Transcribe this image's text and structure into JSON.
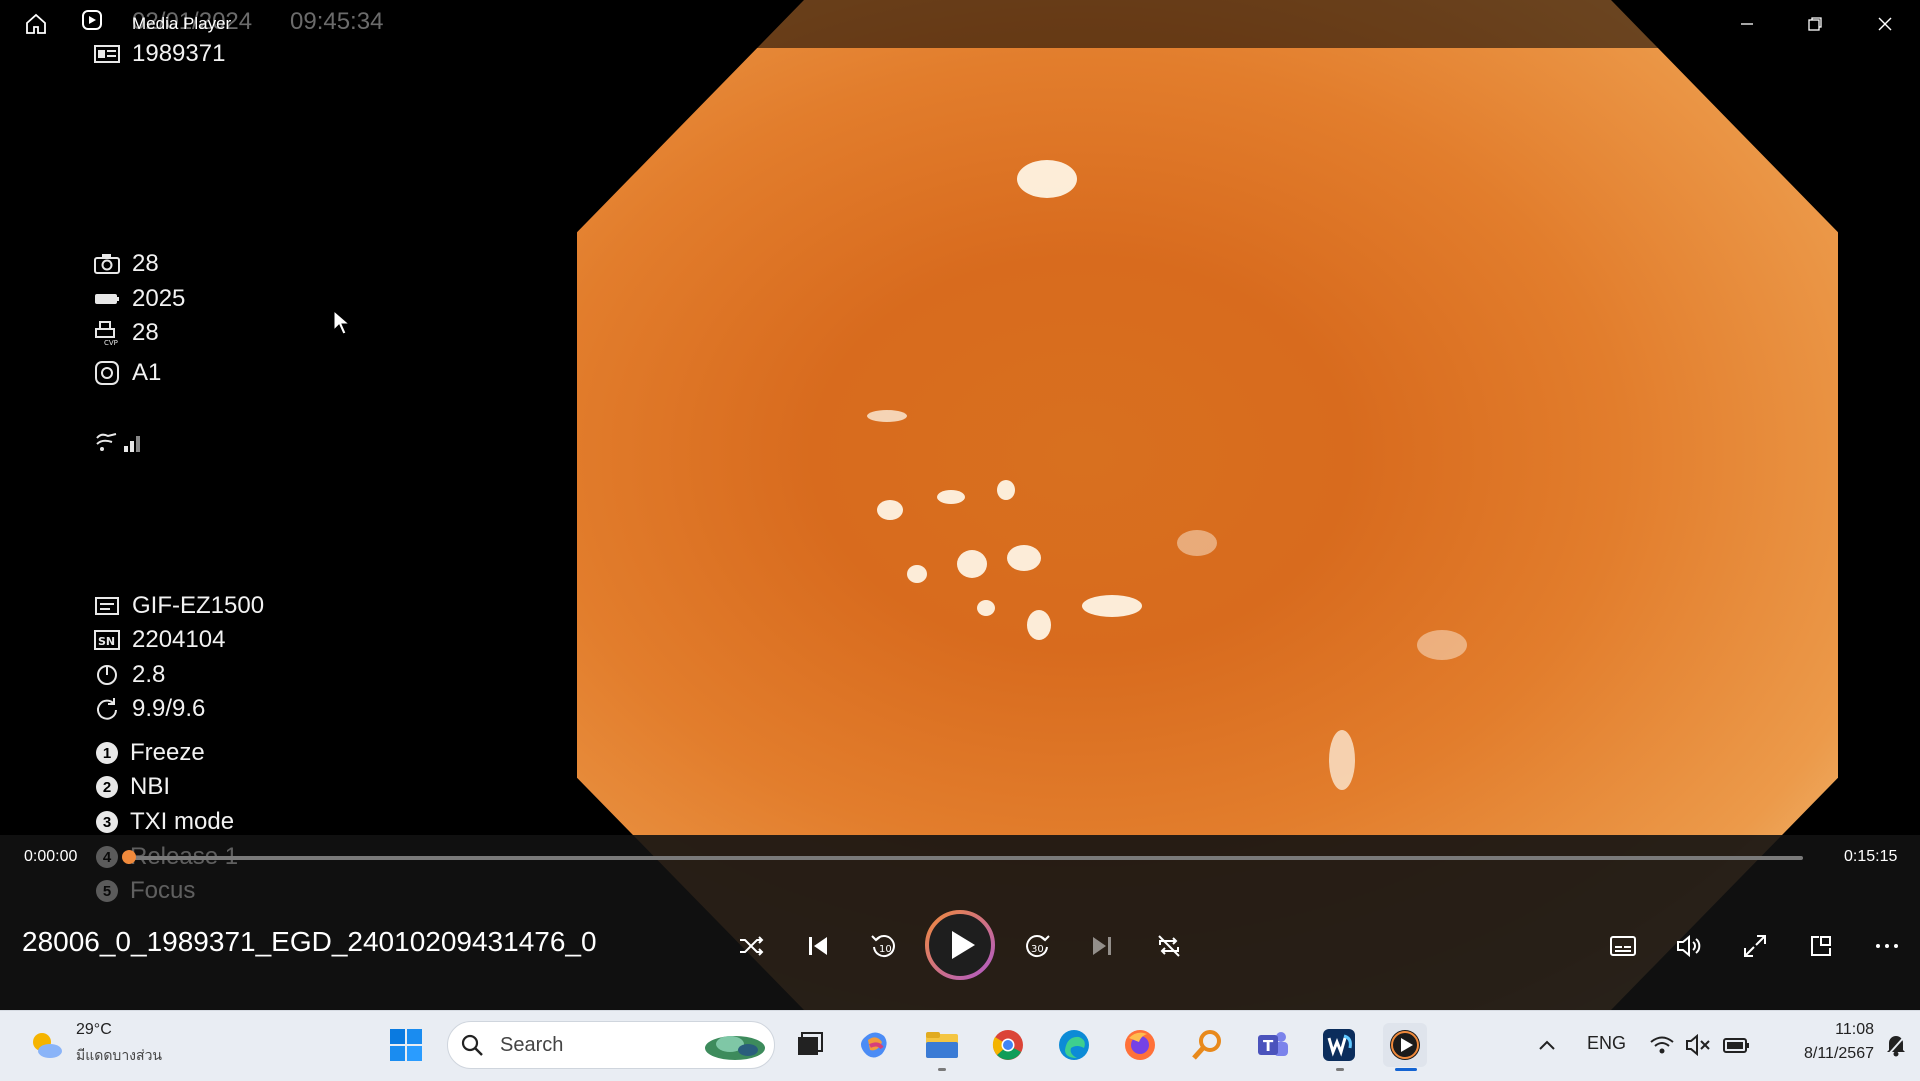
{
  "window": {
    "app_title": "Media Player"
  },
  "overlay": {
    "ghost_date": "02/01/2024",
    "ghost_time": "09:45:34",
    "patient_id": "1989371",
    "camera_count": "28",
    "battery_count": "2025",
    "cvp_count": "28",
    "mode_code": "A1",
    "scope_model": "GIF-EZ1500",
    "serial_number": "2204104",
    "angle_value": "2.8",
    "ratio_value": "9.9/9.6",
    "functions": [
      {
        "num": "1",
        "label": "Freeze"
      },
      {
        "num": "2",
        "label": "NBI"
      },
      {
        "num": "3",
        "label": "TXI mode"
      },
      {
        "num": "4",
        "label": "Release 1"
      },
      {
        "num": "5",
        "label": "Focus"
      }
    ]
  },
  "player": {
    "time_current": "0:00:00",
    "time_total": "0:15:15",
    "progress_fraction": 0.0,
    "file_name": "28006_0_1989371_EGD_24010209431476_0"
  },
  "taskbar": {
    "weather_temp": "29°C",
    "weather_desc": "มีแดดบางส่วน",
    "search_placeholder": "Search",
    "lang": "ENG",
    "clock_time": "11:08",
    "clock_date": "8/11/2567"
  },
  "colors": {
    "accent": "#f08a3c",
    "taskbar_bg": "#e9edf3",
    "video_base": "#d8701f"
  }
}
